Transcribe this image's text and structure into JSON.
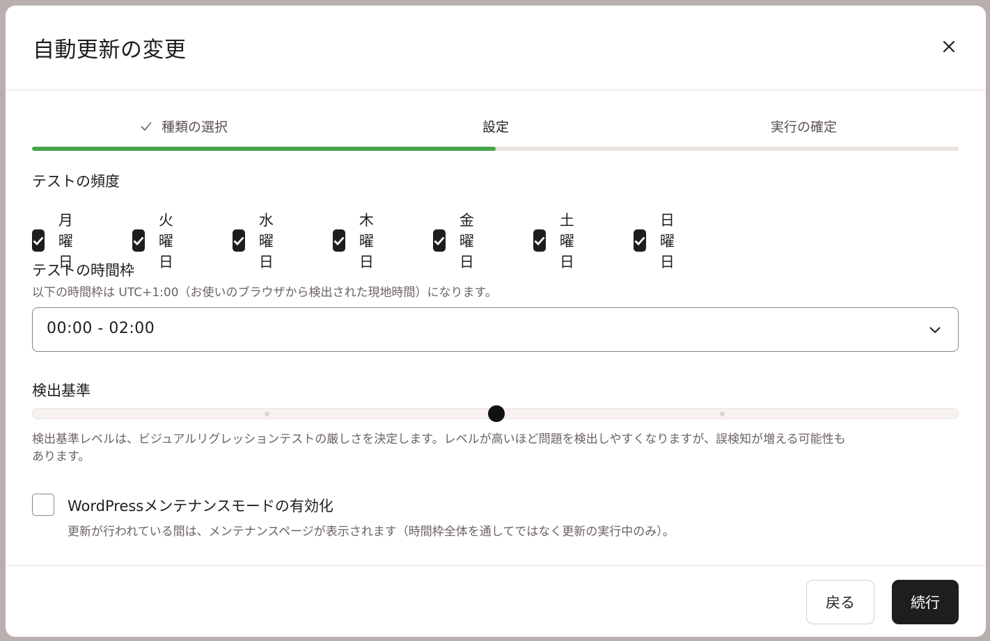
{
  "dialog": {
    "title": "自動更新の変更"
  },
  "steps": [
    {
      "label": "種類の選択",
      "state": "done"
    },
    {
      "label": "設定",
      "state": "active"
    },
    {
      "label": "実行の確定",
      "state": "upcoming"
    }
  ],
  "progress_fraction": 0.5,
  "frequency": {
    "label": "テストの頻度",
    "days": [
      {
        "label": "月曜日",
        "checked": true
      },
      {
        "label": "火曜日",
        "checked": true
      },
      {
        "label": "水曜日",
        "checked": true
      },
      {
        "label": "木曜日",
        "checked": true
      },
      {
        "label": "金曜日",
        "checked": true
      },
      {
        "label": "土曜日",
        "checked": true
      },
      {
        "label": "日曜日",
        "checked": true
      }
    ]
  },
  "timeframe": {
    "label": "テストの時間枠",
    "hint": "以下の時間枠は UTC+1:00（お使いのブラウザから検出された現地時間）になります。",
    "value": "00:00 - 02:00"
  },
  "threshold": {
    "label": "検出基準",
    "level": 2,
    "levels": 5,
    "hint_line1": "検出基準レベルは、ビジュアルリグレッションテストの厳しさを決定します。レベルが高いほど問題を検出しやすくなりますが、誤検知が増える可能性も",
    "hint_line2": "あります。"
  },
  "maintenance": {
    "label": "WordPressメンテナンスモードの有効化",
    "hint": "更新が行われている間は、メンテナンスページが表示されます（時間枠全体を通してではなく更新の実行中のみ）。",
    "checked": false
  },
  "footer": {
    "back_label": "戻る",
    "next_label": "続行"
  }
}
